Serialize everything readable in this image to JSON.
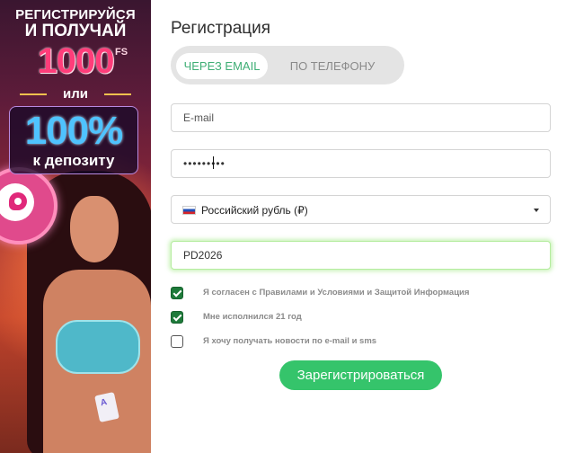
{
  "promo": {
    "line1": "РЕГИСТРИРУЙСЯ",
    "line2": "И ПОЛУЧАЙ",
    "amount": "1000",
    "amount_suffix": "FS",
    "or": "или",
    "percent": "100%",
    "deposit": "к депозиту",
    "card_letter": "A"
  },
  "form": {
    "title": "Регистрация",
    "tabs": [
      {
        "label": "ЧЕРЕЗ EMAIL",
        "active": true
      },
      {
        "label": "ПО ТЕЛЕФОНУ",
        "active": false
      }
    ],
    "email": {
      "placeholder": "E-mail",
      "value": ""
    },
    "password": {
      "value": "•••••••••"
    },
    "currency": {
      "selected": "Российский рубль (₽)",
      "flag_icon": "russia-flag-icon"
    },
    "promo_code": {
      "value": "PD2026"
    },
    "checkboxes": [
      {
        "label": "Я согласен с Правилами и Условиями и Защитой Информация",
        "checked": true
      },
      {
        "label": "Мне исполнился 21 год",
        "checked": true
      },
      {
        "label": "Я хочу получать новости по e-mail и sms",
        "checked": false
      }
    ],
    "submit_label": "Зарегистрироваться"
  },
  "colors": {
    "accent_green": "#35c46b",
    "tab_active_text": "#3fae75",
    "checkbox_checked": "#1e7a3a",
    "promo_pink": "#ff3d7a",
    "promo_blue": "#4fc3ff"
  }
}
